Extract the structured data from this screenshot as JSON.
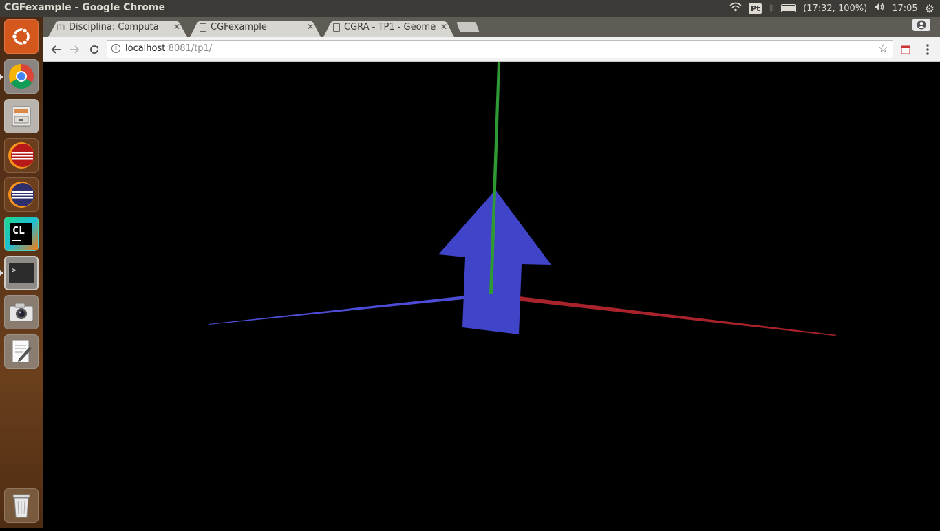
{
  "top_panel": {
    "window_title": "CGFexample - Google Chrome",
    "keyboard_layout": "Pt",
    "battery_status": "(17:32, 100%)",
    "clock": "17:05"
  },
  "launcher": {
    "items": [
      {
        "name": "ubuntu-dash",
        "icon": "ubuntu-logo-icon",
        "color": "#d4571e"
      },
      {
        "name": "chrome",
        "icon": "chrome-icon",
        "color": "#e8e8e8"
      },
      {
        "name": "files",
        "icon": "file-cabinet-icon",
        "color": "#c9c7c2"
      },
      {
        "name": "eclipse-red",
        "icon": "eclipse-icon",
        "color": "#b81a1a"
      },
      {
        "name": "eclipse",
        "icon": "eclipse-icon",
        "color": "#2f2f6b"
      },
      {
        "name": "clion",
        "icon": "clion-icon",
        "glyph": "CL",
        "color": "#1cbf8e"
      },
      {
        "name": "terminal",
        "icon": "terminal-icon",
        "glyph": ">_",
        "color": "#3a3a3a"
      },
      {
        "name": "screenshot",
        "icon": "camera-icon",
        "color": "#d0d0d0"
      },
      {
        "name": "text-editor",
        "icon": "text-editor-icon",
        "color": "#e0e0e0"
      }
    ],
    "trash": {
      "name": "trash",
      "icon": "trash-icon",
      "color": "#d0d0d0"
    }
  },
  "browser": {
    "tabs": [
      {
        "label": "Disciplina: Computa",
        "icon": "moodle-icon",
        "active": false
      },
      {
        "label": "CGFexample",
        "icon": "page-icon",
        "active": true
      },
      {
        "label": "CGRA - TP1 - Geome",
        "icon": "page-icon",
        "active": false
      }
    ],
    "url_host": "localhost",
    "url_path": ":8081/tp1/"
  },
  "scene": {
    "colors": {
      "arrow": "#4044c8",
      "x_axis": "#a8232c",
      "y_axis": "#2f9a34",
      "z_axis": "#4c4cd6",
      "background": "#000000"
    }
  }
}
